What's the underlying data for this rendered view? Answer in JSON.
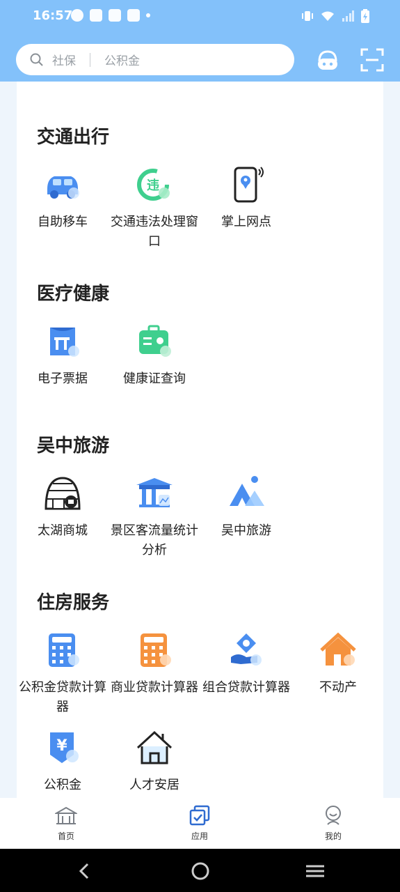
{
  "status": {
    "time": "16:57"
  },
  "search": {
    "item1": "社保",
    "item2": "公积金"
  },
  "sections": [
    {
      "title": "交通出行",
      "items": [
        {
          "label": "自助移车",
          "icon": "car-icon"
        },
        {
          "label": "交通违法处理窗口",
          "icon": "traffic-violation-icon"
        },
        {
          "label": "掌上网点",
          "icon": "phone-location-icon"
        }
      ]
    },
    {
      "title": "医疗健康",
      "items": [
        {
          "label": "电子票据",
          "icon": "receipt-icon"
        },
        {
          "label": "健康证查询",
          "icon": "health-card-icon"
        }
      ]
    },
    {
      "title": "吴中旅游",
      "items": [
        {
          "label": "太湖商城",
          "icon": "shop-igloo-icon"
        },
        {
          "label": "景区客流量统计分析",
          "icon": "scenic-stats-icon"
        },
        {
          "label": "吴中旅游",
          "icon": "mountain-icon"
        }
      ]
    },
    {
      "title": "住房服务",
      "items": [
        {
          "label": "公积金贷款计算器",
          "icon": "calculator-blue-icon"
        },
        {
          "label": "商业贷款计算器",
          "icon": "calculator-orange-icon"
        },
        {
          "label": "组合贷款计算器",
          "icon": "combo-loan-icon"
        },
        {
          "label": "不动产",
          "icon": "house-orange-icon"
        },
        {
          "label": "公积金",
          "icon": "yen-icon"
        },
        {
          "label": "人才安居",
          "icon": "house-outline-icon"
        }
      ]
    }
  ],
  "nav": {
    "home": "首页",
    "apps": "应用",
    "mine": "我的"
  },
  "colors": {
    "header": "#83c1fa",
    "accent": "#4a8ef0",
    "green": "#3fcf8e",
    "orange": "#f5923e"
  }
}
